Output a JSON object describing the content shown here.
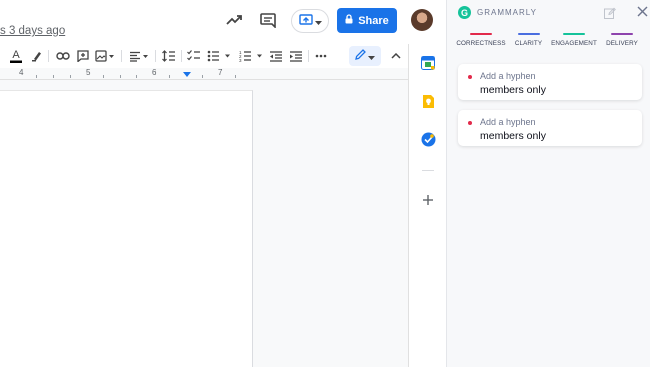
{
  "header": {
    "last_edit": "s 3 days ago",
    "share_label": "Share"
  },
  "ruler": {
    "numbers": [
      "4",
      "5",
      "6",
      "7"
    ]
  },
  "grammarly": {
    "title": "GRAMMARLY",
    "tabs": [
      {
        "label": "CORRECTNESS",
        "color": "#e22a4b"
      },
      {
        "label": "CLARITY",
        "color": "#4a6ee0"
      },
      {
        "label": "ENGAGEMENT",
        "color": "#15c39a"
      },
      {
        "label": "DELIVERY",
        "color": "#8e44ad"
      }
    ],
    "suggestions": [
      {
        "hint": "Add a hyphen",
        "text": "members only"
      },
      {
        "hint": "Add a hyphen",
        "text": "members only"
      }
    ]
  },
  "colors": {
    "share_blue": "#1a73e8",
    "grammarly_green": "#15c39a",
    "correctness_red": "#e22a4b"
  },
  "icons": [
    "activity-trend-icon",
    "comment-icon",
    "present-icon",
    "lock-icon",
    "text-color-icon",
    "highlight-icon",
    "link-icon",
    "add-comment-icon",
    "image-icon",
    "align-icon",
    "line-spacing-icon",
    "checklist-icon",
    "bulleted-list-icon",
    "numbered-list-icon",
    "decrease-indent-icon",
    "increase-indent-icon",
    "more-icon",
    "edit-mode-pencil-icon",
    "collapse-icon",
    "calendar-icon",
    "keep-icon",
    "tasks-icon",
    "add-icon",
    "grammarly-logo-icon",
    "compose-icon",
    "close-icon"
  ]
}
